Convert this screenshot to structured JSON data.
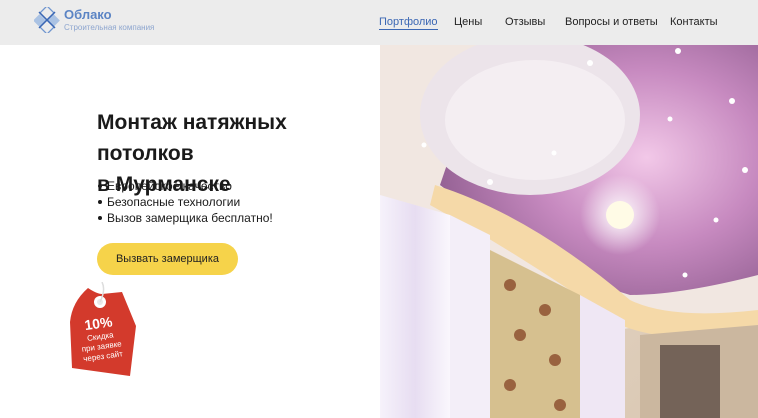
{
  "brand": {
    "name": "Облако",
    "tagline": "Строительная компания",
    "accent": "#5b84c4"
  },
  "nav": {
    "items": [
      {
        "label": "Портфолио",
        "active": true
      },
      {
        "label": "Цены",
        "active": false
      },
      {
        "label": "Отзывы",
        "active": false
      },
      {
        "label": "Вопросы и ответы",
        "active": false
      },
      {
        "label": "Контакты",
        "active": false
      }
    ],
    "active_color": "#3b67b4"
  },
  "hero": {
    "title_line1": "Монтаж натяжных потолков",
    "title_line2": "в Мурманске",
    "bullets": [
      "Европейское качество",
      "Безопасные технологии",
      "Вызов замерщика бесплатно!"
    ],
    "cta_label": "Вызвать замерщика",
    "cta_color": "#f6d34a"
  },
  "promo_tag": {
    "percent": "10%",
    "line1": "Скидка",
    "line2": "при заявке",
    "line3": "через сайт",
    "color": "#d33a2c"
  },
  "photo": {
    "subject": "ceiling-interior-photo"
  }
}
